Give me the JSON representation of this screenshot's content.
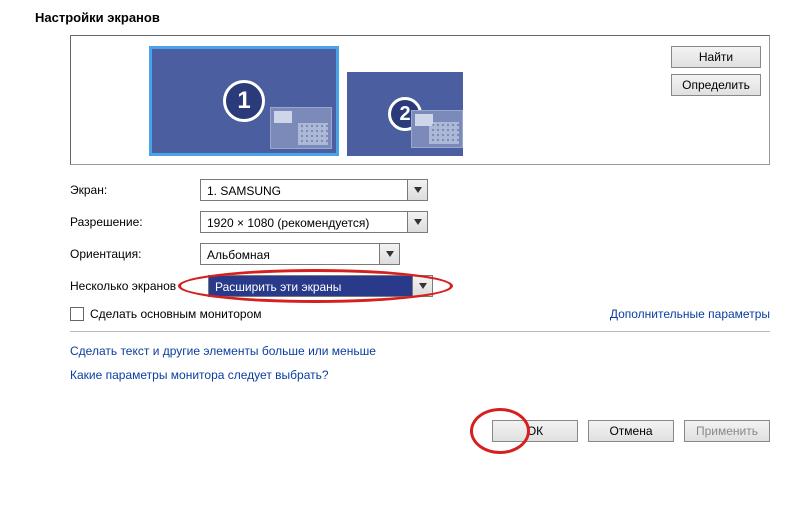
{
  "title": "Настройки экранов",
  "buttons": {
    "find": "Найти",
    "identify": "Определить",
    "ok": "ОК",
    "cancel": "Отмена",
    "apply": "Применить"
  },
  "monitors": {
    "num1": "1",
    "num2": "2"
  },
  "fields": {
    "display_label": "Экран:",
    "display_value": "1. SAMSUNG",
    "resolution_label": "Разрешение:",
    "resolution_value": "1920 × 1080 (рекомендуется)",
    "orientation_label": "Ориентация:",
    "orientation_value": "Альбомная",
    "multi_label": "Несколько экранов",
    "multi_value": "Расширить эти экраны"
  },
  "checkbox": {
    "label": "Сделать основным монитором"
  },
  "links": {
    "advanced": "Дополнительные параметры",
    "textsize": "Сделать текст и другие элементы больше или меньше",
    "which": "Какие параметры монитора следует выбрать?"
  }
}
